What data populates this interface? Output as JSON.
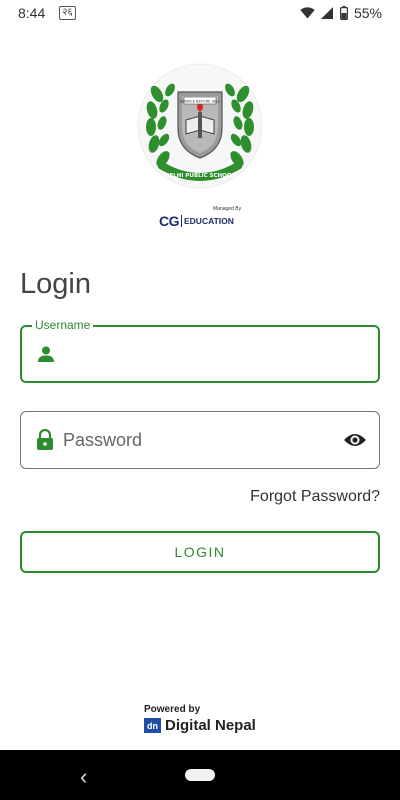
{
  "status_bar": {
    "time": "8:44",
    "notification_badge": "२६",
    "battery_percent": "55%",
    "icons": [
      "wifi-icon",
      "signal-icon",
      "battery-icon"
    ]
  },
  "logo": {
    "school_name": "DELHI PUBLIC SCHOOL",
    "motto": "SERVICE BEFORE SELF",
    "managed_by": "Managed By",
    "cg_letters": "CG",
    "cg_word": "EDUCATION"
  },
  "title": "Login",
  "username": {
    "label": "Username",
    "value": "",
    "icon": "person-icon"
  },
  "password": {
    "placeholder": "Password",
    "value": "",
    "icon": "lock-icon",
    "toggle_icon": "eye-icon"
  },
  "forgot_password": "Forgot Password?",
  "login_button": "LOGIN",
  "footer": {
    "powered_by": "Powered by",
    "brand_mark": "dn",
    "brand_name": "Digital Nepal"
  },
  "colors": {
    "accent": "#2e8b2e",
    "text": "#333333",
    "brand_blue": "#1f4fa3"
  }
}
